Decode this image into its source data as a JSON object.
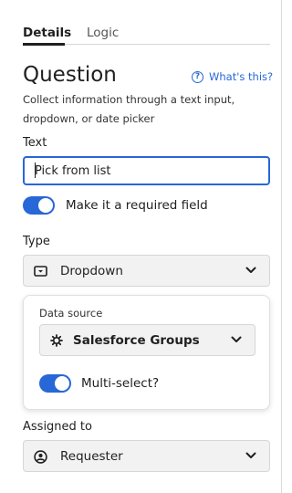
{
  "tabs": [
    {
      "label": "Details",
      "active": true
    },
    {
      "label": "Logic",
      "active": false
    }
  ],
  "question": {
    "title": "Question",
    "help_link": "What's this?",
    "description": "Collect information through a text input, dropdown, or date picker"
  },
  "text_field": {
    "label": "Text",
    "value": "Pick from list"
  },
  "required_toggle": {
    "label": "Make it a required field",
    "on": true
  },
  "type_field": {
    "label": "Type",
    "selected": "Dropdown",
    "icon": "dropdown-icon"
  },
  "data_source": {
    "label": "Data source",
    "selected": "Salesforce Groups",
    "icon": "gear-icon"
  },
  "multiselect_toggle": {
    "label": "Multi-select?",
    "on": true
  },
  "assigned_to": {
    "label": "Assigned to",
    "selected": "Requester",
    "icon": "user-circle-icon"
  },
  "colors": {
    "accent": "#2767d8",
    "select_bg": "#f2f2f2",
    "border": "#d6d6d6"
  }
}
